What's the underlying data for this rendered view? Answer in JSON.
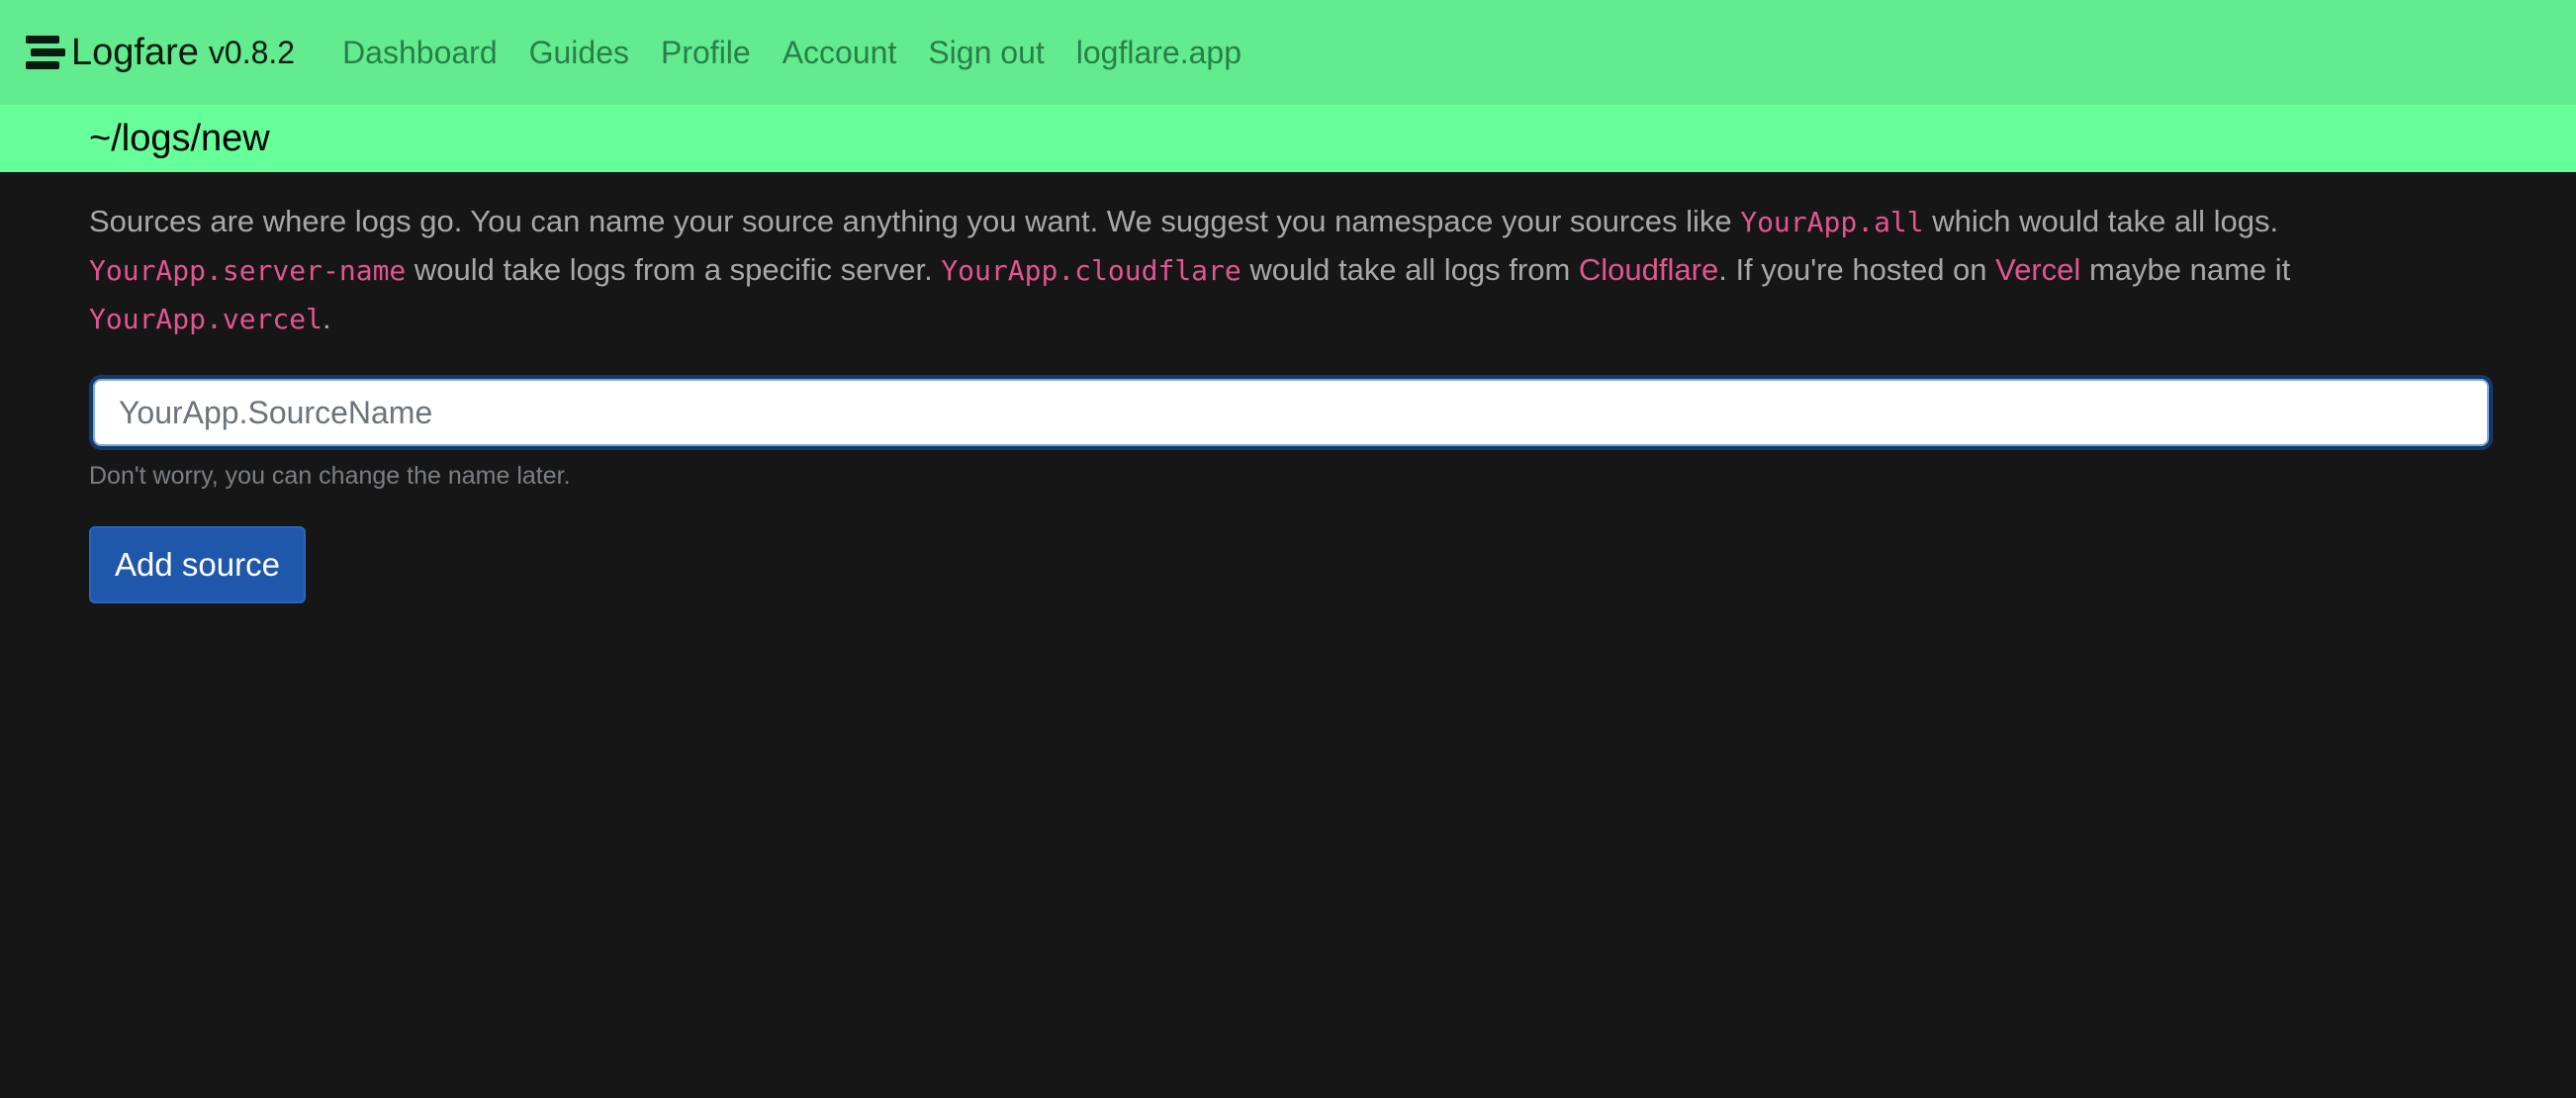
{
  "navbar": {
    "brand_name": "Logfare",
    "version": "v0.8.2",
    "links": [
      {
        "label": "Dashboard"
      },
      {
        "label": "Guides"
      },
      {
        "label": "Profile"
      },
      {
        "label": "Account"
      },
      {
        "label": "Sign out"
      },
      {
        "label": "logflare.app"
      }
    ]
  },
  "subheader": {
    "title": "~/logs/new"
  },
  "intro": {
    "t1": "Sources are where logs go. You can name your source anything you want. We suggest you namespace your sources like ",
    "c1": "YourApp.all",
    "t2": " which would take all logs. ",
    "c2": "YourApp.server-name",
    "t3": " would take logs from a specific server. ",
    "c3": "YourApp.cloudflare",
    "t4": " would take all logs from ",
    "l1": "Cloudflare",
    "t5": ". If you're hosted on ",
    "l2": "Vercel",
    "t6": " maybe name it ",
    "c4": "YourApp.vercel",
    "t7": "."
  },
  "form": {
    "placeholder": "YourApp.SourceName",
    "value": "",
    "help_text": "Don't worry, you can change the name later.",
    "submit_label": "Add source"
  },
  "colors": {
    "navbar_bg": "#62eb8f",
    "subheader_bg": "#66ff99",
    "page_bg": "#161616",
    "accent_pink": "#e3558f",
    "button_blue": "#1f57ab"
  }
}
